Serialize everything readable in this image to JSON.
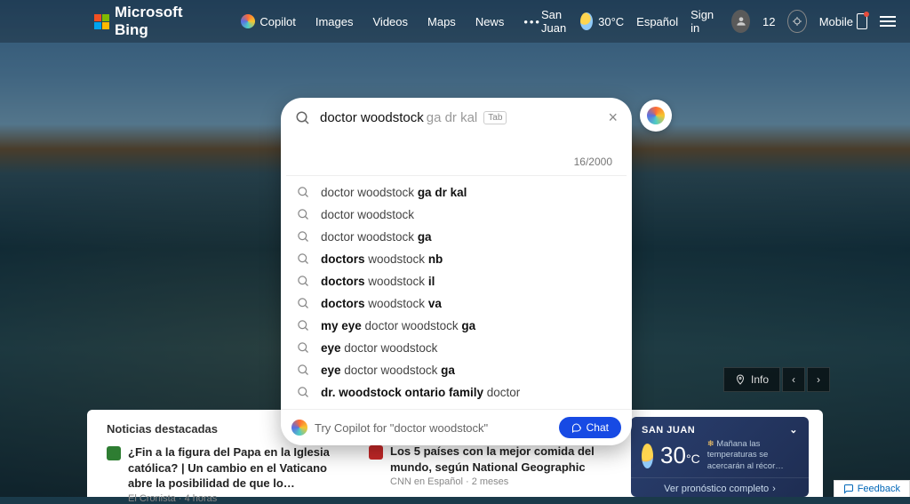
{
  "header": {
    "brand": "Microsoft Bing",
    "nav": {
      "copilot": "Copilot",
      "images": "Images",
      "videos": "Videos",
      "maps": "Maps",
      "news": "News",
      "more": "•••"
    },
    "location": "San Juan",
    "temp": "30°C",
    "language": "Español",
    "signin": "Sign in",
    "rewards_points": "12",
    "mobile": "Mobile"
  },
  "search": {
    "typed": "doctor woodstock",
    "ghost": "ga dr kal",
    "tab_hint": "Tab",
    "counter": "16/2000",
    "suggestions": [
      {
        "pre": "doctor woodstock ",
        "bold": "ga dr kal",
        "post": ""
      },
      {
        "pre": "doctor woodstock",
        "bold": "",
        "post": ""
      },
      {
        "pre": "doctor woodstock ",
        "bold": "ga",
        "post": ""
      },
      {
        "pre": "",
        "bold": "doctors",
        "post_plain": " woodstock ",
        "bold2": "nb"
      },
      {
        "pre": "",
        "bold": "doctors",
        "post_plain": " woodstock ",
        "bold2": "il"
      },
      {
        "pre": "",
        "bold": "doctors",
        "post_plain": " woodstock ",
        "bold2": "va"
      },
      {
        "pre": "",
        "bold": "my eye",
        "post_plain": " doctor woodstock ",
        "bold2": "ga"
      },
      {
        "pre": "",
        "bold": "eye",
        "post_plain": " doctor woodstock",
        "bold2": ""
      },
      {
        "pre": "",
        "bold": "eye",
        "post_plain": " doctor woodstock ",
        "bold2": "ga"
      },
      {
        "pre": "",
        "bold": "dr. woodstock ontario family",
        "post_plain": " doctor",
        "bold2": ""
      }
    ],
    "copilot_prompt": "Try Copilot for \"doctor woodstock\"",
    "chat_label": "Chat"
  },
  "info_bar": {
    "label": "Info"
  },
  "news": {
    "heading": "Noticias destacadas",
    "items": [
      {
        "title": "¿Fin a la figura del Papa en la Iglesia católica? | Un cambio en el Vaticano abre la posibilidad de que lo…",
        "source": "El Cronista",
        "age": "4 horas"
      },
      {
        "title": "Los 5 países con la mejor comida del mundo, según National Geographic",
        "source": "CNN en Español",
        "age": "2 meses"
      }
    ]
  },
  "weather_card": {
    "location": "SAN JUAN",
    "temp": "30",
    "unit": "°C",
    "forecast": "Mañana las temperaturas se acercarán al récor…",
    "link": "Ver pronóstico completo"
  },
  "feedback": "Feedback"
}
